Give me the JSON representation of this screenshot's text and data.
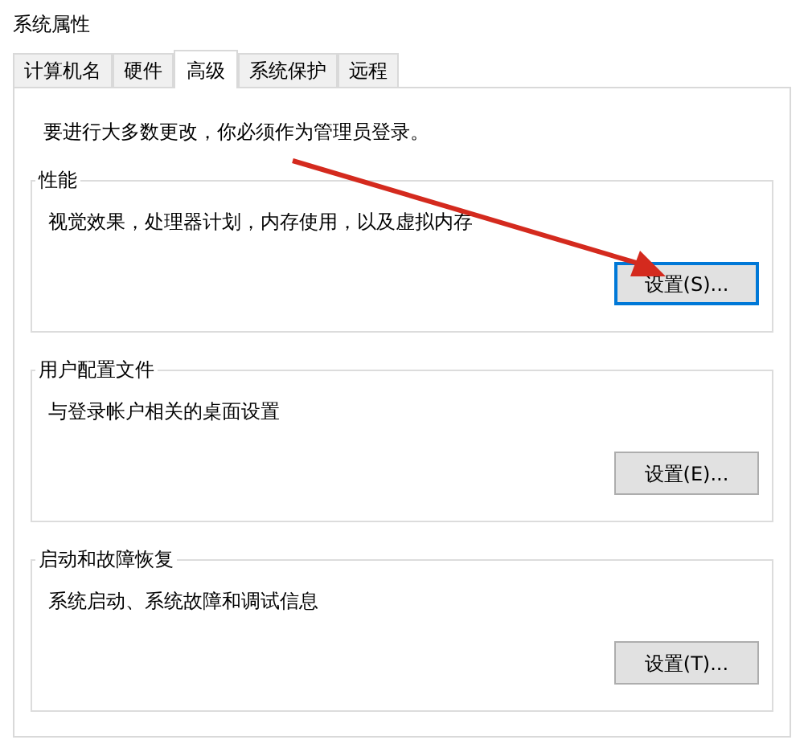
{
  "window": {
    "title": "系统属性"
  },
  "tabs": [
    {
      "label": "计算机名",
      "selected": false
    },
    {
      "label": "硬件",
      "selected": false
    },
    {
      "label": "高级",
      "selected": true
    },
    {
      "label": "系统保护",
      "selected": false
    },
    {
      "label": "远程",
      "selected": false
    }
  ],
  "notice": "要进行大多数更改，你必须作为管理员登录。",
  "groups": [
    {
      "title": "性能",
      "description": "视觉效果，处理器计划，内存使用，以及虚拟内存",
      "button": {
        "label": "设置(S)...",
        "default": true
      }
    },
    {
      "title": "用户配置文件",
      "description": "与登录帐户相关的桌面设置",
      "button": {
        "label": "设置(E)...",
        "default": false
      }
    },
    {
      "title": "启动和故障恢复",
      "description": "系统启动、系统故障和调试信息",
      "button": {
        "label": "设置(T)...",
        "default": false
      }
    }
  ]
}
